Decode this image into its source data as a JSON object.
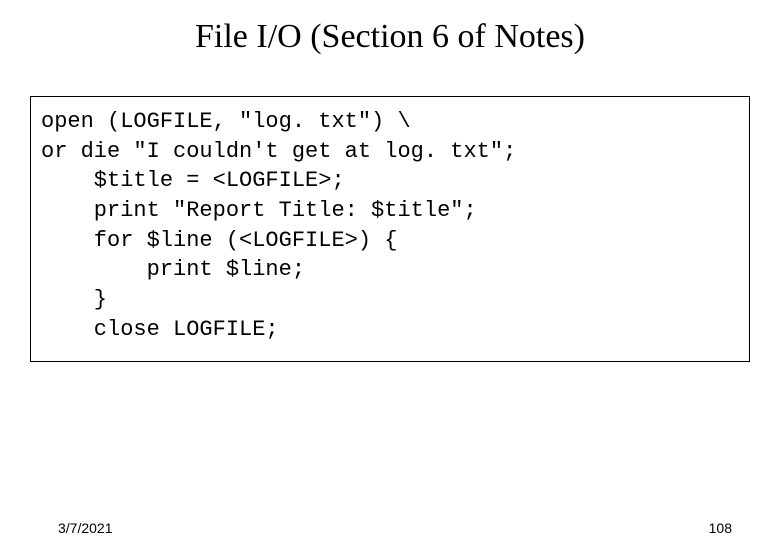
{
  "slide": {
    "title": "File I/O (Section 6 of Notes)",
    "code_line_1": "open (LOGFILE, \"log. txt\") \\",
    "code_line_2": "or die \"I couldn't get at log. txt\";",
    "code_line_3": "",
    "code_line_4": "    $title = <LOGFILE>;",
    "code_line_5": "    print \"Report Title: $title\";",
    "code_line_6": "    for $line (<LOGFILE>) {",
    "code_line_7": "        print $line;",
    "code_line_8": "    }",
    "code_line_9": "    close LOGFILE;",
    "footer_date": "3/7/2021",
    "footer_page": "108"
  }
}
